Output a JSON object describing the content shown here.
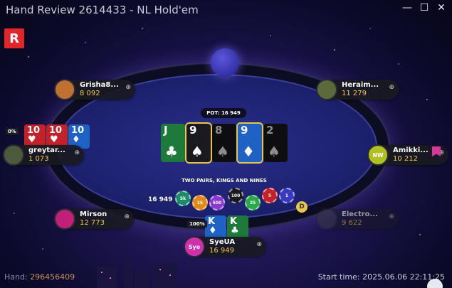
{
  "window": {
    "title": "Hand Review 2614433 - NL Hold'em",
    "controls": [
      "minimize-icon",
      "maximize-icon",
      "close-icon"
    ]
  },
  "logo": {
    "letter": "R",
    "color": "#e0262a"
  },
  "table": {
    "pot_label": "POT: 16 949",
    "hand_name": "TWO PAIRS, KINGS AND NINES",
    "chip_total": "16 949",
    "dealer_button": "D",
    "board": [
      {
        "rank": "J",
        "suit": "♣",
        "suit_name": "clubs",
        "highlight": false,
        "dim": false
      },
      {
        "rank": "9",
        "suit": "♠",
        "suit_name": "spades",
        "highlight": true,
        "dim": false
      },
      {
        "rank": "8",
        "suit": "♠",
        "suit_name": "spades",
        "highlight": false,
        "dim": true
      },
      {
        "rank": "9",
        "suit": "♦",
        "suit_name": "diamonds",
        "highlight": true,
        "dim": false
      },
      {
        "rank": "2",
        "suit": "♠",
        "suit_name": "spades",
        "highlight": false,
        "dim": true
      }
    ],
    "chips": [
      {
        "label": "5k",
        "color": "#1d8a6a"
      },
      {
        "label": "1k",
        "color": "#e08a1a"
      },
      {
        "label": "500",
        "color": "#8a3ad0"
      },
      {
        "label": "100",
        "color": "#1a1a1e"
      },
      {
        "label": "25",
        "color": "#2aa84a"
      },
      {
        "label": "5",
        "color": "#c4222a"
      },
      {
        "label": "1",
        "color": "#3a3ac0"
      }
    ]
  },
  "seats": [
    {
      "name": "Grisha8...",
      "stack": "8 092",
      "avatar_color": "#c07030",
      "avatar_label": "",
      "dim": false
    },
    {
      "name": "Heraim...",
      "stack": "11 279",
      "avatar_color": "#5a6a3a",
      "avatar_label": "",
      "dim": false
    },
    {
      "name": "greytar...",
      "stack": "1 073",
      "avatar_color": "#4a5a3a",
      "avatar_label": "",
      "dim": false,
      "equity": "0%",
      "hole": [
        {
          "rank": "10",
          "suit": "♥",
          "suit_name": "hearts"
        },
        {
          "rank": "10",
          "suit": "♥",
          "suit_name": "hearts"
        },
        {
          "rank": "10",
          "suit": "♦",
          "suit_name": "diamonds"
        }
      ]
    },
    {
      "name": "Amikki...",
      "stack": "10 212",
      "avatar_color": "#b0c020",
      "avatar_label": "NW",
      "dim": false
    },
    {
      "name": "Mirson",
      "stack": "12 773",
      "avatar_color": "#c0207a",
      "avatar_label": "",
      "dim": false
    },
    {
      "name": "Electro...",
      "stack": "9 622",
      "avatar_color": "#3a3a44",
      "avatar_label": "",
      "dim": true
    },
    {
      "name": "SyeUA",
      "stack": "16 949",
      "avatar_color": "#d030b0",
      "avatar_label": "Sye",
      "dim": false,
      "equity": "100%",
      "hole": [
        {
          "rank": "K",
          "suit": "♦",
          "suit_name": "diamonds"
        },
        {
          "rank": "K",
          "suit": "♣",
          "suit_name": "clubs"
        }
      ]
    }
  ],
  "footer": {
    "hand_label": "Hand:",
    "hand_number": "296456409",
    "start_time": "Start time: 2025.06.06 22:11:25"
  }
}
